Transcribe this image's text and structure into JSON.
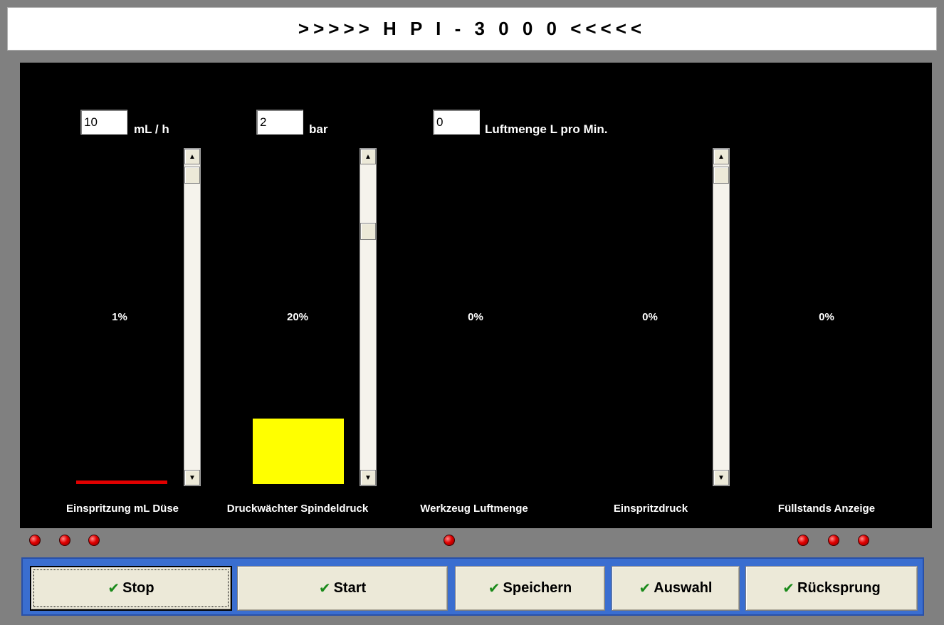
{
  "title": ">>>>> H P I - 3 0 0 0 <<<<<",
  "inputs": {
    "injection": {
      "value": "10",
      "unit": "mL / h"
    },
    "pressure": {
      "value": "2",
      "unit": "bar"
    },
    "air": {
      "value": "0",
      "unit": "Luftmenge L pro Min."
    }
  },
  "gauges": [
    {
      "label": "Einspritzung mL Düse",
      "percent": "1%",
      "level": 0.01,
      "color": "#e00000"
    },
    {
      "label": "Druckwächter Spindeldruck",
      "percent": "20%",
      "level": 0.2,
      "color": "#ffff00"
    },
    {
      "label": "Werkzeug Luftmenge",
      "percent": "0%",
      "level": 0.0
    },
    {
      "label": "Einspritzdruck",
      "percent": "0%",
      "level": 0.0
    },
    {
      "label": "Füllstands Anzeige",
      "percent": "0%",
      "level": 0.0
    }
  ],
  "icons": {
    "scroll_up": "▲",
    "scroll_down": "▼",
    "check": "✔"
  },
  "buttons": [
    {
      "label": "Stop"
    },
    {
      "label": "Start"
    },
    {
      "label": "Speichern"
    },
    {
      "label": "Auswahl"
    },
    {
      "label": "Rücksprung"
    }
  ],
  "colors": {
    "led": "#e00000",
    "button_bar": "#3a6ed0",
    "display_bg": "#000000"
  }
}
